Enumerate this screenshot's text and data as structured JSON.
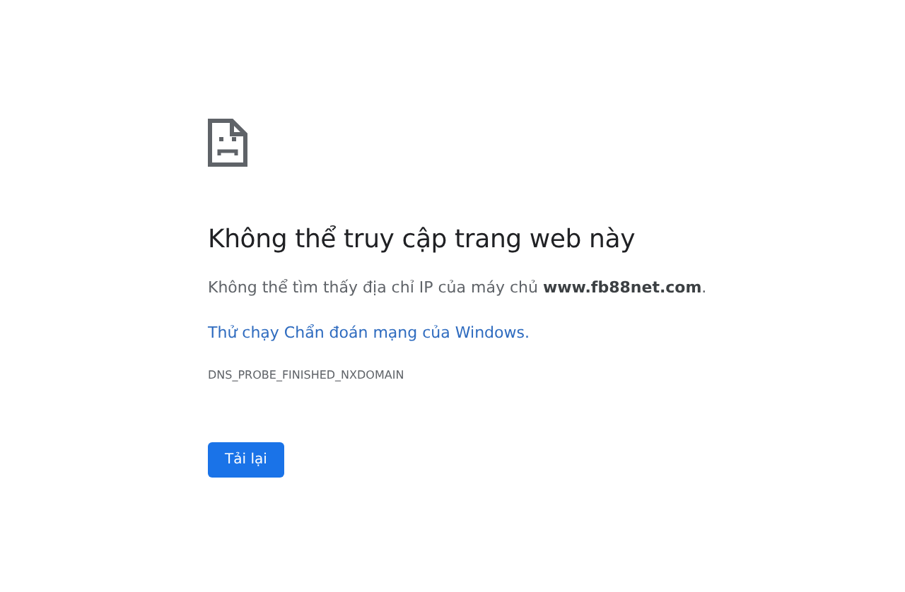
{
  "heading": "Không thể truy cập trang web này",
  "message": "Không thể tìm thấy địa chỉ IP của máy chủ **www.fb88net.com**.",
  "suggestion_link": "Thử chạy Chẩn đoán mạng của Windows.",
  "error_code": "DNS_PROBE_FINISHED_NXDOMAIN",
  "buttons": [
    {
      "label": "Tải lại",
      "kind": "primary"
    }
  ]
}
